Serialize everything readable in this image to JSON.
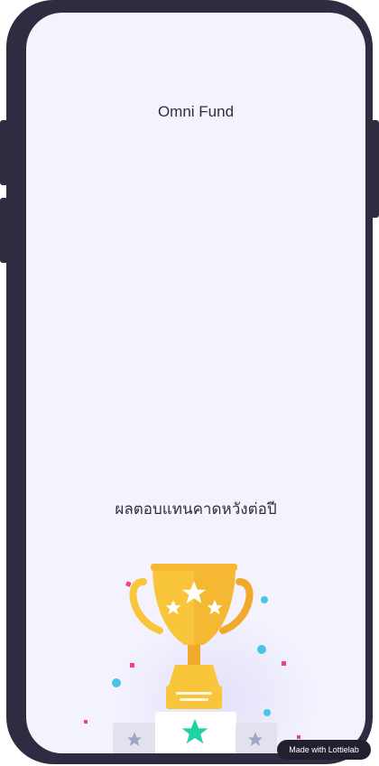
{
  "app": {
    "title": "Omni Fund",
    "subtitle": "ผลตอบแทนคาดหวังต่อปี"
  },
  "animation": {
    "icons": [
      "trophy-icon",
      "star-icon",
      "confetti-icon"
    ],
    "colors": {
      "trophy": "#f9c53b",
      "trophy_shade": "#f0a92a",
      "star_green": "#1fd3a3",
      "star_gray": "#9ea6c4",
      "confetti_pink": "#f0427a",
      "confetti_blue": "#49c3e6"
    }
  },
  "badge": {
    "label": "Made with Lottielab"
  },
  "colors": {
    "frame": "#2f2b40",
    "screen_bg": "#f4f3fd",
    "text": "#2e2e3e"
  }
}
